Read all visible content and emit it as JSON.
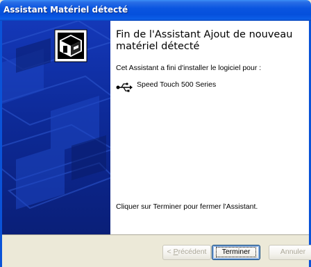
{
  "window": {
    "title": "Assistant Matériel détecté"
  },
  "content": {
    "heading": "Fin de l'Assistant Ajout de nouveau matériel détecté",
    "intro": "Cet Assistant a fini d'installer le logiciel pour :",
    "device_name": "Speed Touch 500 Series",
    "close_instruction": "Cliquer sur Terminer pour fermer l'Assistant."
  },
  "buttons": {
    "back": {
      "prefix": "< ",
      "accel": "P",
      "rest": "récédent"
    },
    "finish": {
      "label": "Terminer"
    },
    "cancel": {
      "label": "Annuler"
    }
  },
  "icons": {
    "wizard": "hardware-wizard-icon",
    "device": "usb-icon"
  },
  "colors": {
    "titlebar": "#0550dc",
    "left_panel": "#0d2a98",
    "button_bar": "#ece9d8"
  }
}
